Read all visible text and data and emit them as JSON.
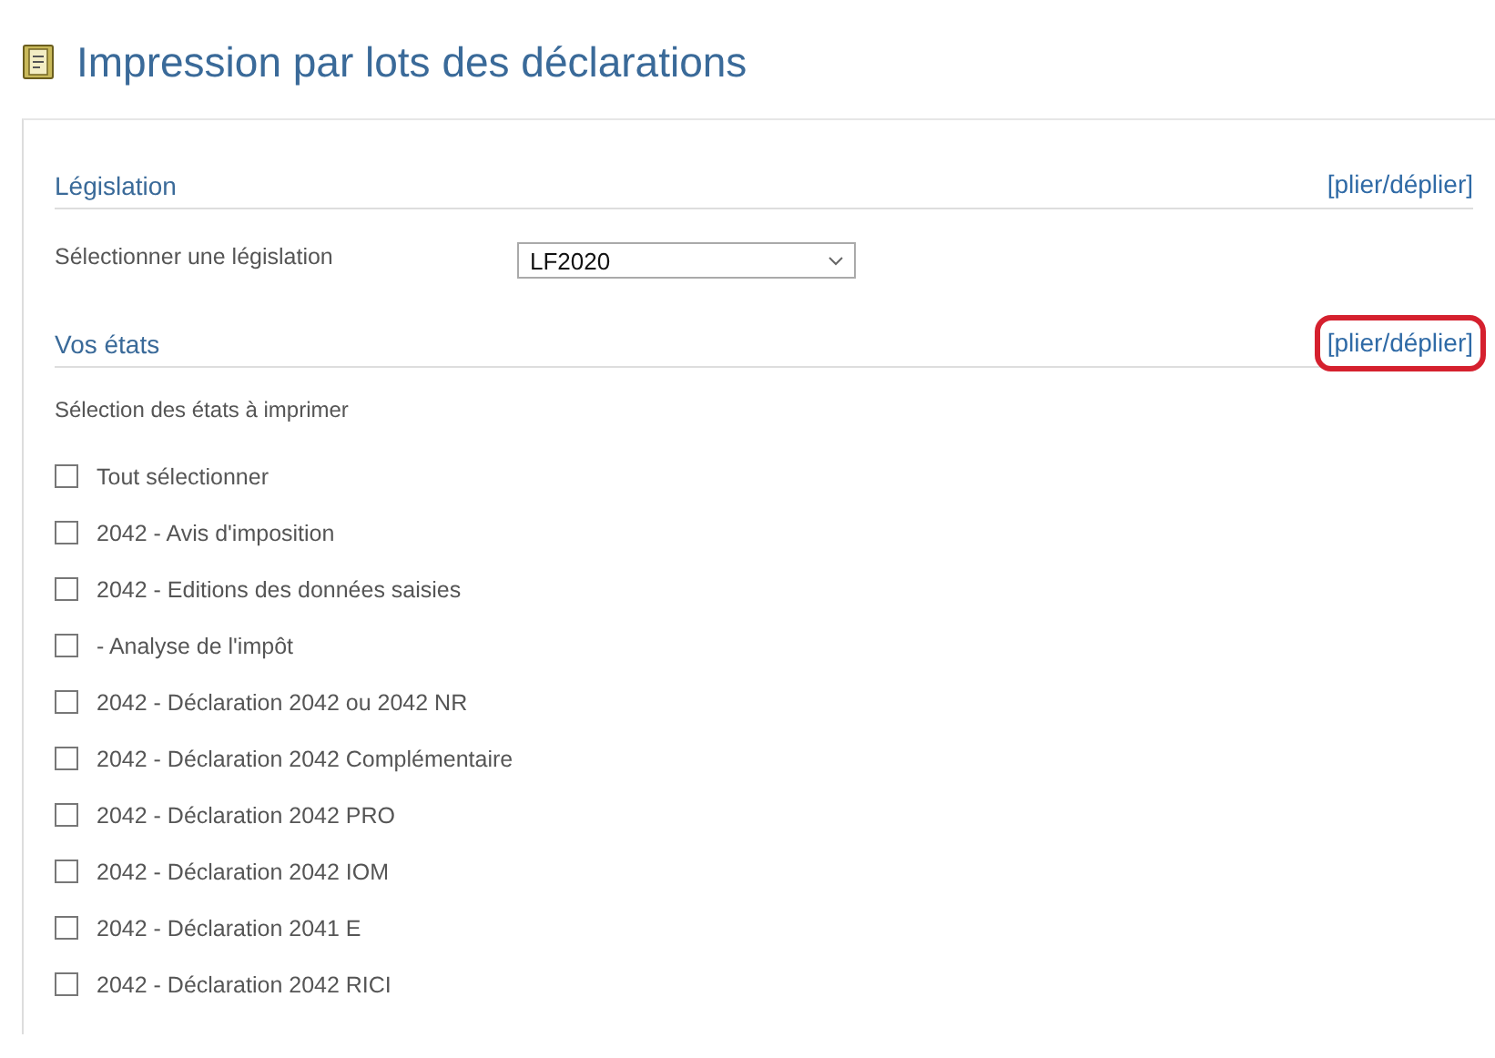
{
  "page": {
    "title": "Impression par lots des déclarations"
  },
  "sections": [
    {
      "kind": "form",
      "title": "Législation",
      "toggle": "[plier/déplier]",
      "highlighted": false,
      "field_label": "Sélectionner une législation",
      "select_value": "LF2020"
    },
    {
      "kind": "checklist",
      "title": "Vos états",
      "toggle": "[plier/déplier]",
      "highlighted": true,
      "intro": "Sélection des états à imprimer",
      "items": [
        {
          "label": "Tout sélectionner",
          "checked": false
        },
        {
          "label": "2042 - Avis d'imposition",
          "checked": false
        },
        {
          "label": "2042 - Editions des données saisies",
          "checked": false
        },
        {
          "label": "- Analyse de l'impôt",
          "checked": false
        },
        {
          "label": "2042 - Déclaration 2042 ou 2042 NR",
          "checked": false
        },
        {
          "label": "2042 - Déclaration 2042 Complémentaire",
          "checked": false
        },
        {
          "label": "2042 - Déclaration 2042 PRO",
          "checked": false
        },
        {
          "label": "2042 - Déclaration 2042 IOM",
          "checked": false
        },
        {
          "label": "2042 - Déclaration 2041 E",
          "checked": false
        },
        {
          "label": "2042 - Déclaration 2042 RICI",
          "checked": false
        }
      ]
    }
  ]
}
